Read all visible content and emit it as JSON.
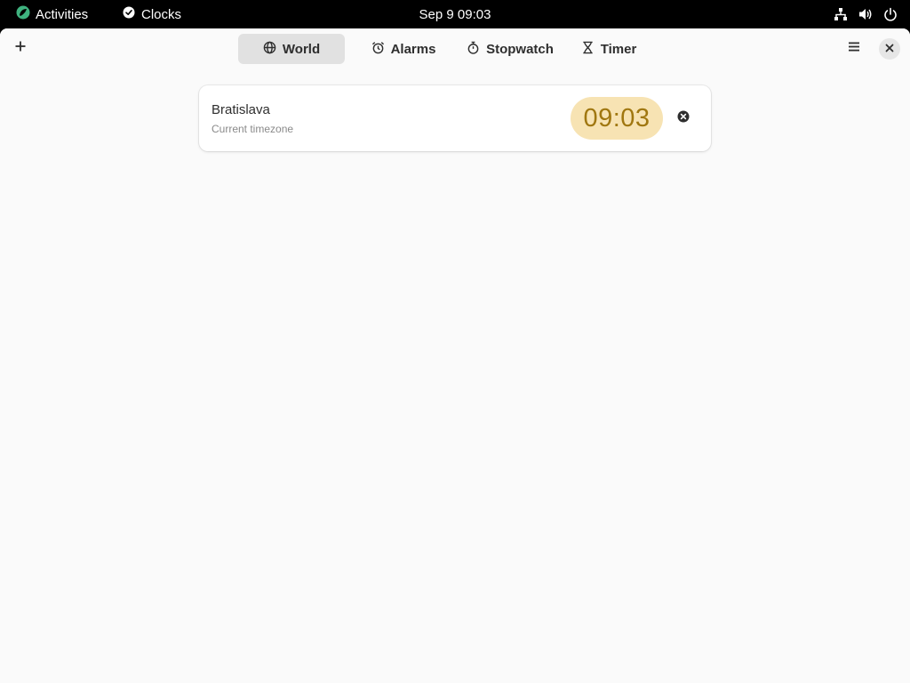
{
  "topbar": {
    "activities_label": "Activities",
    "app_name": "Clocks",
    "datetime": "Sep 9  09:03",
    "icons": [
      "network-icon",
      "volume-icon",
      "power-icon"
    ]
  },
  "headerbar": {
    "add_icon": "plus-icon",
    "menu_icon": "hamburger-menu-icon",
    "close_icon": "close-icon",
    "tabs": [
      {
        "label": "World",
        "icon": "globe-icon",
        "active": true
      },
      {
        "label": "Alarms",
        "icon": "alarm-clock-icon",
        "active": false
      },
      {
        "label": "Stopwatch",
        "icon": "stopwatch-icon",
        "active": false
      },
      {
        "label": "Timer",
        "icon": "hourglass-icon",
        "active": false
      }
    ]
  },
  "world": {
    "clocks": [
      {
        "city": "Bratislava",
        "subtitle": "Current timezone",
        "time": "09:03",
        "remove_icon": "remove-circle-icon"
      }
    ]
  },
  "colors": {
    "time_pill_bg": "#f7e3b3",
    "time_pill_text": "#a07710",
    "active_tab_bg": "#e1e1e1",
    "window_bg": "#fafafa",
    "topbar_bg": "#000000"
  }
}
